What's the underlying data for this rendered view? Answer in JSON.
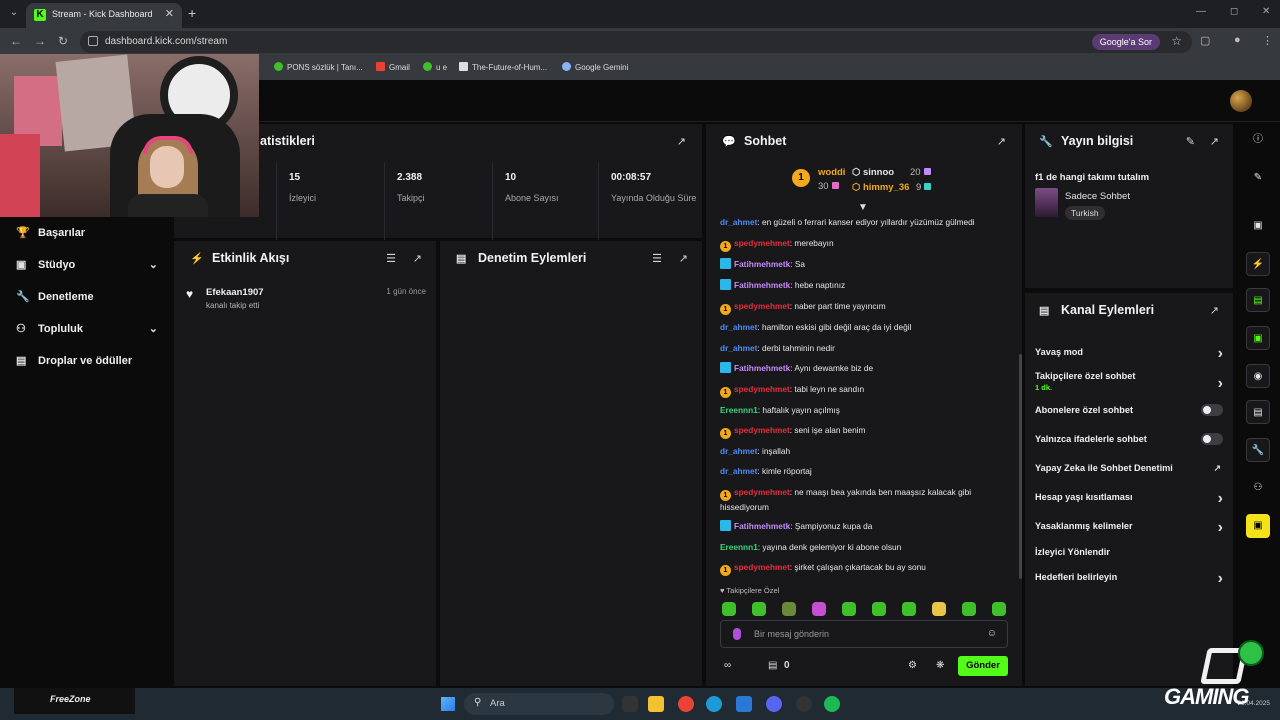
{
  "browser": {
    "tab_title": "Stream - Kick Dashboard",
    "url": "dashboard.kick.com/stream",
    "google_button": "Google'a Sor",
    "bookmarks": [
      "PONS sözlük | Tanı...",
      "Gmail",
      "u e",
      "The-Future-of-Hum...",
      "Google Gemini"
    ]
  },
  "sidebar": {
    "items": [
      {
        "label": "Başarılar",
        "icon": "trophy-icon"
      },
      {
        "label": "Stüdyo",
        "icon": "studio-icon"
      },
      {
        "label": "Denetleme",
        "icon": "wrench-icon"
      },
      {
        "label": "Topluluk",
        "icon": "community-icon"
      },
      {
        "label": "Droplar ve ödüller",
        "icon": "drops-icon"
      }
    ]
  },
  "stats": {
    "title": "atistikleri",
    "cells": [
      {
        "value": "15",
        "label": "İzleyici"
      },
      {
        "value": "2.388",
        "label": "Takipçi"
      },
      {
        "value": "10",
        "label": "Abone Sayısı"
      },
      {
        "value": "00:08:57",
        "label": "Yayında Olduğu Süre"
      }
    ]
  },
  "activity": {
    "title": "Etkinlik Akışı",
    "items": [
      {
        "user": "Efekaan1907",
        "text": "kanalı takip etti",
        "time": "1 gün önce"
      }
    ]
  },
  "moderation": {
    "title": "Denetim Eylemleri"
  },
  "chat": {
    "title": "Sohbet",
    "leaderboard": [
      {
        "name": "woddi",
        "count": "30",
        "color": "#f2a91b"
      },
      {
        "name": "sinnoo",
        "count": "20",
        "color": "#e5e5e5"
      },
      {
        "name": "himmy_36",
        "count": "9",
        "color": "#f2a91b"
      }
    ],
    "messages": [
      {
        "user": "dr_ahmet",
        "color": "#4e8cf2",
        "badge": "",
        "text": ": en güzeli o ferrari kanser ediyor yıllardır yüzümüz gülmedi"
      },
      {
        "user": "spedymehmet",
        "color": "#e62e3d",
        "badge": "sub",
        "text": ": merebayın"
      },
      {
        "user": "Fatihmehmetk",
        "color": "#c58af9",
        "badge": "vip",
        "text": ": Sa"
      },
      {
        "user": "Fatihmehmetk",
        "color": "#c58af9",
        "badge": "vip",
        "text": ": hebe naptınız"
      },
      {
        "user": "spedymehmet",
        "color": "#e62e3d",
        "badge": "sub",
        "text": ": naber part time yayıncım"
      },
      {
        "user": "dr_ahmet",
        "color": "#4e8cf2",
        "badge": "",
        "text": ": hamilton eskisi gibi değil araç da iyi değil"
      },
      {
        "user": "dr_ahmet",
        "color": "#4e8cf2",
        "badge": "",
        "text": ": derbi tahminin nedir"
      },
      {
        "user": "Fatihmehmetk",
        "color": "#c58af9",
        "badge": "vip",
        "text": ": Aynı dewamke biz de"
      },
      {
        "user": "spedymehmet",
        "color": "#e62e3d",
        "badge": "sub",
        "text": ": tabi leyn ne sandın"
      },
      {
        "user": "Ereennn1",
        "color": "#3bd47a",
        "badge": "",
        "text": ": haftalık yayın açılmış"
      },
      {
        "user": "spedymehmet",
        "color": "#e62e3d",
        "badge": "sub",
        "text": ": seni işe alan benim"
      },
      {
        "user": "dr_ahmet",
        "color": "#4e8cf2",
        "badge": "",
        "text": ": inşallah"
      },
      {
        "user": "dr_ahmet",
        "color": "#4e8cf2",
        "badge": "",
        "text": ": kimle röportaj"
      },
      {
        "user": "spedymehmet",
        "color": "#e62e3d",
        "badge": "sub",
        "text": ": ne maaşı bea yakında ben maaşsız kalacak gibi hissediyorum"
      },
      {
        "user": "Fatihmehmetk",
        "color": "#c58af9",
        "badge": "vip",
        "text": ": Şampiyonuz kupa da"
      },
      {
        "user": "Ereennn1",
        "color": "#3bd47a",
        "badge": "",
        "text": ": yayına denk gelemiyor ki abone olsun"
      },
      {
        "user": "spedymehmet",
        "color": "#e62e3d",
        "badge": "sub",
        "text": ": şirket çalışan çıkartacak bu ay sonu"
      }
    ],
    "emote_header": "Takipçilere Özel",
    "input_placeholder": "Bir mesaj gönderin",
    "points": "0",
    "send_label": "Gönder"
  },
  "stream_info": {
    "title": "Yayın bilgisi",
    "stream_title": "f1 de hangi takımı tutalım",
    "category": "Sadece Sohbet",
    "tag": "Turkish"
  },
  "channel_actions": {
    "title": "Kanal Eylemleri",
    "items": [
      {
        "label": "Yavaş mod",
        "control": "chevron",
        "sub": ""
      },
      {
        "label": "Takipçilere özel sohbet",
        "control": "chevron",
        "sub": "1 dk."
      },
      {
        "label": "Abonelere özel sohbet",
        "control": "toggle",
        "sub": ""
      },
      {
        "label": "Yalnızca ifadelerle sohbet",
        "control": "toggle",
        "sub": ""
      },
      {
        "label": "Yapay Zeka ile Sohbet Denetimi",
        "control": "external",
        "sub": ""
      },
      {
        "label": "Hesap yaşı kısıtlaması",
        "control": "chevron",
        "sub": ""
      },
      {
        "label": "Yasaklanmış kelimeler",
        "control": "chevron",
        "sub": ""
      },
      {
        "label": "İzleyici Yönlendir",
        "control": "none",
        "sub": ""
      },
      {
        "label": "Hedefleri belirleyin",
        "control": "chevron",
        "sub": ""
      }
    ]
  },
  "taskbar": {
    "search_placeholder": "Ara",
    "overlay_brand": "FreeZone",
    "overlay_gaming": "GAMING",
    "clock_date": "23.04.2025"
  },
  "colors": {
    "kick_green": "#53fc18",
    "panel_bg": "#18181b",
    "page_bg": "#0b0b0c"
  }
}
